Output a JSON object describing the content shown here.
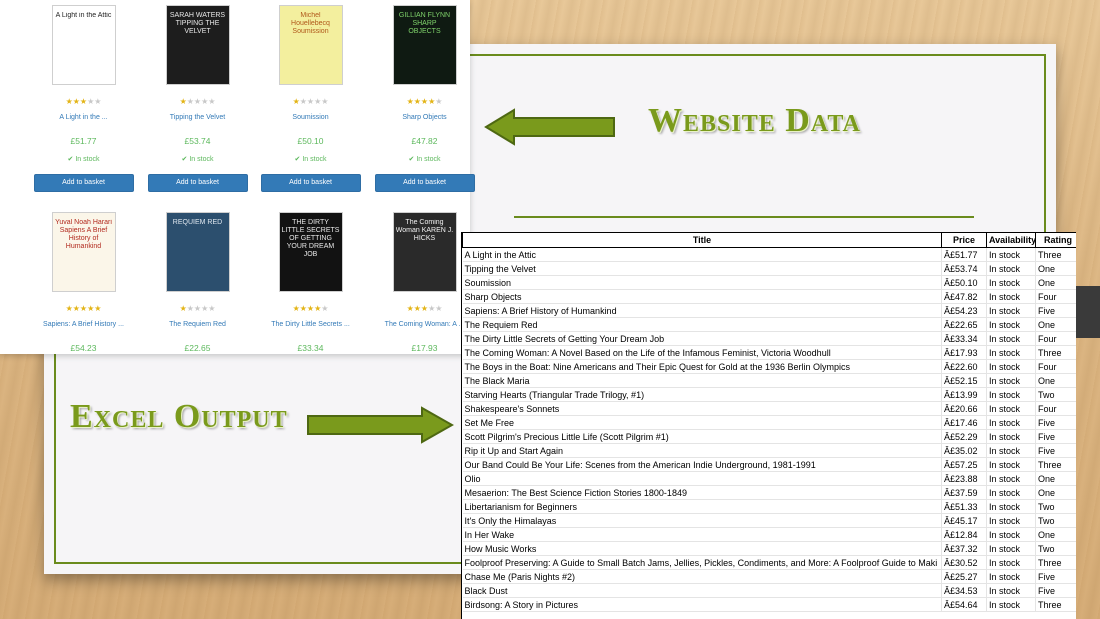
{
  "slide": {
    "website_label": "Website Data",
    "excel_label": "Excel Output"
  },
  "colors": {
    "accent_green": "#6a8b1d",
    "link_blue": "#337ab7",
    "price_green": "#5cb85c",
    "star_gold": "#e3b416"
  },
  "site": {
    "in_stock": "In stock",
    "basket_label": "Add to basket",
    "books": [
      {
        "title": "A Light in the ...",
        "price": "£51.77",
        "rating": 3,
        "cover": "A Light in the Attic",
        "cover_bg": "#ffffff",
        "cover_fg": "#222222"
      },
      {
        "title": "Tipping the Velvet",
        "price": "£53.74",
        "rating": 1,
        "cover": "SARAH WATERS TIPPING THE VELVET",
        "cover_bg": "#1d1d1d",
        "cover_fg": "#e8e8e8"
      },
      {
        "title": "Soumission",
        "price": "£50.10",
        "rating": 1,
        "cover": "Michel Houellebecq Soumission",
        "cover_bg": "#f3ef9e",
        "cover_fg": "#b0581a"
      },
      {
        "title": "Sharp Objects",
        "price": "£47.82",
        "rating": 4,
        "cover": "GILLIAN FLYNN SHARP OBJECTS",
        "cover_bg": "#0f1a12",
        "cover_fg": "#7fd36b"
      },
      {
        "title": "Sapiens: A Brief History ...",
        "price": "£54.23",
        "rating": 5,
        "cover": "Yuval Noah Harari Sapiens A Brief History of Humankind",
        "cover_bg": "#fbf6e9",
        "cover_fg": "#b22a1e"
      },
      {
        "title": "The Requiem Red",
        "price": "£22.65",
        "rating": 1,
        "cover": "REQUIEM RED",
        "cover_bg": "#2c4f6e",
        "cover_fg": "#dfe7ef"
      },
      {
        "title": "The Dirty Little Secrets ...",
        "price": "£33.34",
        "rating": 4,
        "cover": "THE DIRTY LITTLE SECRETS OF GETTING YOUR DREAM JOB",
        "cover_bg": "#121212",
        "cover_fg": "#e8e8e8"
      },
      {
        "title": "The Coming Woman: A ...",
        "price": "£17.93",
        "rating": 3,
        "cover": "The Coming Woman KAREN J. HICKS",
        "cover_bg": "#2a2a2a",
        "cover_fg": "#f2f2f2"
      }
    ]
  },
  "excel": {
    "headers": [
      "Title",
      "Price",
      "Availability",
      "Rating"
    ],
    "rows": [
      [
        "A Light in the Attic",
        "Â£51.77",
        "In stock",
        "Three"
      ],
      [
        "Tipping the Velvet",
        "Â£53.74",
        "In stock",
        "One"
      ],
      [
        "Soumission",
        "Â£50.10",
        "In stock",
        "One"
      ],
      [
        "Sharp Objects",
        "Â£47.82",
        "In stock",
        "Four"
      ],
      [
        "Sapiens: A Brief History of Humankind",
        "Â£54.23",
        "In stock",
        "Five"
      ],
      [
        "The Requiem Red",
        "Â£22.65",
        "In stock",
        "One"
      ],
      [
        "The Dirty Little Secrets of Getting Your Dream Job",
        "Â£33.34",
        "In stock",
        "Four"
      ],
      [
        "The Coming Woman: A Novel Based on the Life of the Infamous Feminist, Victoria Woodhull",
        "Â£17.93",
        "In stock",
        "Three"
      ],
      [
        "The Boys in the Boat: Nine Americans and Their Epic Quest for Gold at the 1936 Berlin Olympics",
        "Â£22.60",
        "In stock",
        "Four"
      ],
      [
        "The Black Maria",
        "Â£52.15",
        "In stock",
        "One"
      ],
      [
        "Starving Hearts (Triangular Trade Trilogy, #1)",
        "Â£13.99",
        "In stock",
        "Two"
      ],
      [
        "Shakespeare's Sonnets",
        "Â£20.66",
        "In stock",
        "Four"
      ],
      [
        "Set Me Free",
        "Â£17.46",
        "In stock",
        "Five"
      ],
      [
        "Scott Pilgrim's Precious Little Life (Scott Pilgrim #1)",
        "Â£52.29",
        "In stock",
        "Five"
      ],
      [
        "Rip it Up and Start Again",
        "Â£35.02",
        "In stock",
        "Five"
      ],
      [
        "Our Band Could Be Your Life: Scenes from the American Indie Underground, 1981-1991",
        "Â£57.25",
        "In stock",
        "Three"
      ],
      [
        "Olio",
        "Â£23.88",
        "In stock",
        "One"
      ],
      [
        "Mesaerion: The Best Science Fiction Stories 1800-1849",
        "Â£37.59",
        "In stock",
        "One"
      ],
      [
        "Libertarianism for Beginners",
        "Â£51.33",
        "In stock",
        "Two"
      ],
      [
        "It's Only the Himalayas",
        "Â£45.17",
        "In stock",
        "Two"
      ],
      [
        "In Her Wake",
        "Â£12.84",
        "In stock",
        "One"
      ],
      [
        "How Music Works",
        "Â£37.32",
        "In stock",
        "Two"
      ],
      [
        "Foolproof Preserving: A Guide to Small Batch Jams, Jellies, Pickles, Condiments, and More: A Foolproof Guide to Maki",
        "Â£30.52",
        "In stock",
        "Three"
      ],
      [
        "Chase Me (Paris Nights #2)",
        "Â£25.27",
        "In stock",
        "Five"
      ],
      [
        "Black Dust",
        "Â£34.53",
        "In stock",
        "Five"
      ],
      [
        "Birdsong: A Story in Pictures",
        "Â£54.64",
        "In stock",
        "Three"
      ]
    ]
  }
}
